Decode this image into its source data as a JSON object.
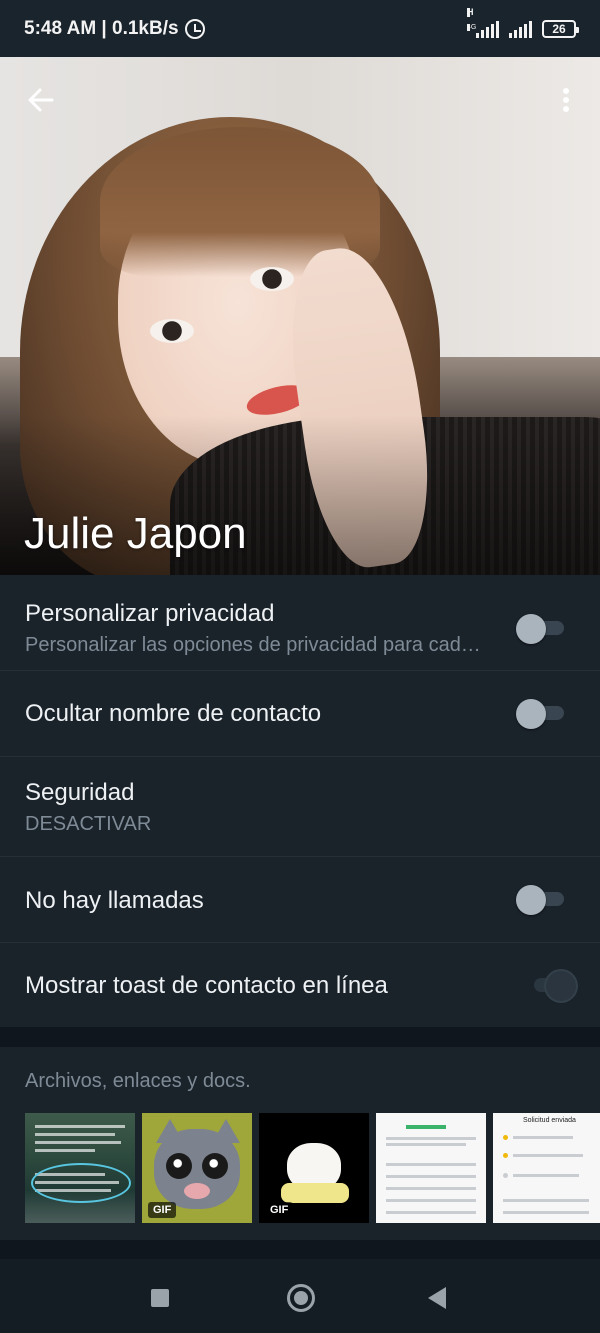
{
  "status_bar": {
    "time_speed": "5:48 AM | 0.1kB/s",
    "network_type": "H",
    "network_sub": "4G",
    "battery_level": "26",
    "icons": [
      "alarm-icon",
      "signal-icon",
      "signal-icon",
      "battery-icon"
    ]
  },
  "header": {
    "back_icon": "arrow-left-icon",
    "menu_icon": "more-vertical-icon",
    "contact_name": "Julie Japon"
  },
  "settings": {
    "items": [
      {
        "title": "Personalizar privacidad",
        "subtitle": "Personalizar las opciones de privacidad para cad…",
        "toggle": false
      },
      {
        "title": "Ocultar nombre de contacto",
        "toggle": false
      },
      {
        "title": "Seguridad",
        "subtitle": "DESACTIVAR"
      },
      {
        "title": "No hay llamadas",
        "toggle": false
      },
      {
        "title": "Mostrar toast de contacto en línea",
        "toggle": true
      }
    ]
  },
  "media": {
    "title": "Archivos, enlaces y docs.",
    "thumbnails": [
      {
        "kind": "image",
        "description_icon": "chat-screenshot-thumbnail"
      },
      {
        "kind": "gif",
        "badge": "GIF"
      },
      {
        "kind": "gif",
        "badge": "GIF"
      },
      {
        "kind": "image",
        "description_icon": "receipt-screenshot-thumbnail"
      },
      {
        "kind": "image",
        "description_icon": "withdrawal-screenshot-thumbnail",
        "header_text": "Solicitud enviada"
      }
    ]
  },
  "navigation": {
    "recent_icon": "square-icon",
    "home_icon": "circle-home-icon",
    "back_icon": "triangle-back-icon"
  },
  "colors": {
    "background": "#0f161d",
    "panel": "#1a222a",
    "text_primary": "#eef1f3",
    "text_secondary": "#7e8b96",
    "toggle_knob": "#aab4bc"
  }
}
